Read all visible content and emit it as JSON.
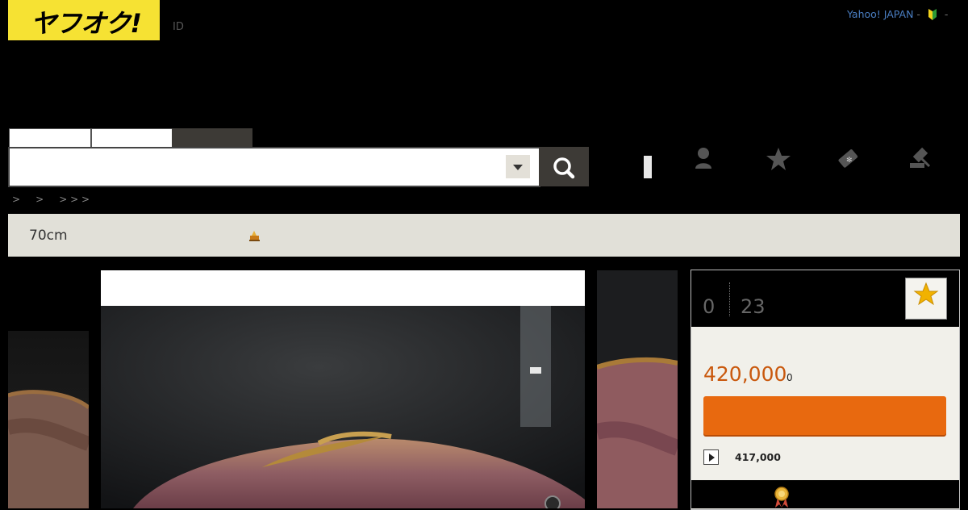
{
  "header": {
    "logo_text": "ヤフオク!",
    "id_link": "ID",
    "yahoo_japan": "Yahoo! JAPAN",
    "sep1": "-",
    "sep2": "-"
  },
  "search": {
    "tabs": [
      "",
      "",
      ""
    ],
    "input_value": "",
    "placeholder": ""
  },
  "nav_icons": [
    "user-icon",
    "star-icon",
    "coupon-tag-icon",
    "auction-gavel-icon"
  ],
  "breadcrumb": ">     >     > > >",
  "item": {
    "title": "70cm"
  },
  "bid_panel": {
    "bids": "0",
    "time_left": "23",
    "current_price": "420,000",
    "tax": "0",
    "bid_button_label": "",
    "buy_now_price": "417,000"
  },
  "colors": {
    "logo_bg": "#f6e233",
    "title_bar": "#e1e0d8",
    "price": "#c9580d",
    "bid_button": "#e8690f",
    "link": "#4a7ec2"
  }
}
